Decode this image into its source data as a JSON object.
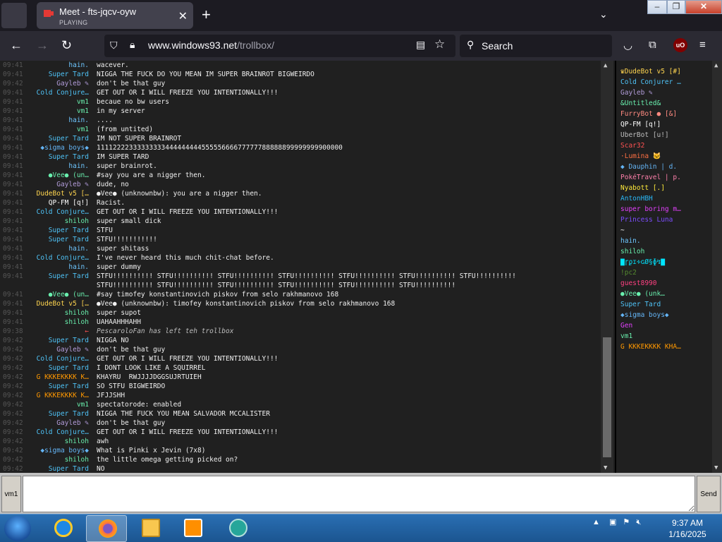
{
  "browser": {
    "tab_title": "Meet - fts-jqcv-oyw",
    "tab_status": "PLAYING",
    "url_host": "www.windows93.net",
    "url_path": "/trollbox/",
    "search_placeholder": "Search",
    "ublock_label": "uO"
  },
  "chat": {
    "messages": [
      {
        "time": "09:41",
        "nick": "hain.",
        "nick_color": "#6ec6ff",
        "text": "wacever."
      },
      {
        "time": "09:41",
        "nick": "Super Tard",
        "nick_color": "#4fc3f7",
        "text": "NIGGA THE FUCK DO YOU MEAN IM SUPER BRAINROT BIGWEIRDO"
      },
      {
        "time": "09:42",
        "nick": "Gayleb ✎",
        "nick_color": "#b39ddb",
        "text": "don't be that guy"
      },
      {
        "time": "09:41",
        "nick": "Cold Conjure…",
        "nick_color": "#4fc3f7",
        "text": "GET OUT OR I WILL FREEZE YOU INTENTIONALLY!!!"
      },
      {
        "time": "09:41",
        "nick": "vm1",
        "nick_color": "#69f0ae",
        "text": "becaue no bw users"
      },
      {
        "time": "09:41",
        "nick": "vm1",
        "nick_color": "#69f0ae",
        "text": "in my server"
      },
      {
        "time": "09:41",
        "nick": "hain.",
        "nick_color": "#6ec6ff",
        "text": "...."
      },
      {
        "time": "09:41",
        "nick": "vm1",
        "nick_color": "#69f0ae",
        "text": "(from untited)"
      },
      {
        "time": "09:41",
        "nick": "Super Tard",
        "nick_color": "#4fc3f7",
        "text": "IM NOT SUPER BRAINROT"
      },
      {
        "time": "09:41",
        "nick": "◆sigma boys◆",
        "nick_color": "#64b5f6",
        "text": "1111222233333333344444444455555666677777788888899999999900000"
      },
      {
        "time": "09:41",
        "nick": "Super Tard",
        "nick_color": "#4fc3f7",
        "text": "IM SUPER TARD"
      },
      {
        "time": "09:41",
        "nick": "hain.",
        "nick_color": "#6ec6ff",
        "text": "super brainrot."
      },
      {
        "time": "09:41",
        "nick": "●Vee● (un…",
        "nick_color": "#69f0ae",
        "text": "#say you are a nigger then."
      },
      {
        "time": "09:41",
        "nick": "Gayleb ✎",
        "nick_color": "#b39ddb",
        "text": "dude, no"
      },
      {
        "time": "09:41",
        "nick": "DudeBot v5 […",
        "nick_color": "#ffd54f",
        "text": "●Vee● (unknownbw): you are a nigger then."
      },
      {
        "time": "09:41",
        "nick": "QP-FM [q!]",
        "nick_color": "#ffffff",
        "text": "Racist."
      },
      {
        "time": "09:41",
        "nick": "Cold Conjure…",
        "nick_color": "#4fc3f7",
        "text": "GET OUT OR I WILL FREEZE YOU INTENTIONALLY!!!"
      },
      {
        "time": "09:41",
        "nick": "shiloh",
        "nick_color": "#69f0ae",
        "text": "super small dick"
      },
      {
        "time": "09:41",
        "nick": "Super Tard",
        "nick_color": "#4fc3f7",
        "text": "STFU"
      },
      {
        "time": "09:41",
        "nick": "Super Tard",
        "nick_color": "#4fc3f7",
        "text": "STFU!!!!!!!!!!!"
      },
      {
        "time": "09:41",
        "nick": "hain.",
        "nick_color": "#6ec6ff",
        "text": "super shitass"
      },
      {
        "time": "09:41",
        "nick": "Cold Conjure…",
        "nick_color": "#4fc3f7",
        "text": "I've never heard this much chit-chat before."
      },
      {
        "time": "09:41",
        "nick": "hain.",
        "nick_color": "#6ec6ff",
        "text": "super dummy"
      },
      {
        "time": "09:41",
        "nick": "Super Tard",
        "nick_color": "#4fc3f7",
        "text": "STFU!!!!!!!!!! STFU!!!!!!!!!! STFU!!!!!!!!!! STFU!!!!!!!!!! STFU!!!!!!!!!! STFU!!!!!!!!!! STFU!!!!!!!!!!"
      },
      {
        "time": "",
        "nick": "",
        "nick_color": "#4fc3f7",
        "text": "STFU!!!!!!!!!! STFU!!!!!!!!!! STFU!!!!!!!!!! STFU!!!!!!!!!! STFU!!!!!!!!!! STFU!!!!!!!!!!"
      },
      {
        "time": "09:41",
        "nick": "●Vee● (un…",
        "nick_color": "#69f0ae",
        "text": "#say timofey konstantinovich piskov from selo rakhmanovo 168"
      },
      {
        "time": "09:41",
        "nick": "DudeBot v5 […",
        "nick_color": "#ffd54f",
        "text": "●Vee● (unknownbw): timofey konstantinovich piskov from selo rakhmanovo 168"
      },
      {
        "time": "09:41",
        "nick": "shiloh",
        "nick_color": "#69f0ae",
        "text": "super supot"
      },
      {
        "time": "09:41",
        "nick": "shiloh",
        "nick_color": "#69f0ae",
        "text": "UAHAAHHHAHH"
      },
      {
        "time": "09:38",
        "nick": "←",
        "nick_color": "#ff5252",
        "text": "PescaroloFan has left teh trollbox",
        "event": true
      },
      {
        "time": "09:42",
        "nick": "Super Tard",
        "nick_color": "#4fc3f7",
        "text": "NIGGA NO"
      },
      {
        "time": "09:42",
        "nick": "Gayleb ✎",
        "nick_color": "#b39ddb",
        "text": "don't be that guy"
      },
      {
        "time": "09:42",
        "nick": "Cold Conjure…",
        "nick_color": "#4fc3f7",
        "text": "GET OUT OR I WILL FREEZE YOU INTENTIONALLY!!!"
      },
      {
        "time": "09:42",
        "nick": "Super Tard",
        "nick_color": "#4fc3f7",
        "text": "I DONT LOOK LIKE A SQUIRREL"
      },
      {
        "time": "09:42",
        "nick": "G KKKEKKKK K…",
        "nick_color": "#ff9800",
        "text": "KHAYRU  RWJJJJDGGSUJRTUIEH"
      },
      {
        "time": "09:42",
        "nick": "Super Tard",
        "nick_color": "#4fc3f7",
        "text": "SO STFU BIGWEIRDO"
      },
      {
        "time": "09:42",
        "nick": "G KKKEKKKK K…",
        "nick_color": "#ff9800",
        "text": "JFJJSHH"
      },
      {
        "time": "09:42",
        "nick": "vm1",
        "nick_color": "#69f0ae",
        "text": "spectatorode: enabled"
      },
      {
        "time": "09:42",
        "nick": "Super Tard",
        "nick_color": "#4fc3f7",
        "text": "NIGGA THE FUCK YOU MEAN SALVADOR MCCALISTER"
      },
      {
        "time": "09:42",
        "nick": "Gayleb ✎",
        "nick_color": "#b39ddb",
        "text": "don't be that guy"
      },
      {
        "time": "09:42",
        "nick": "Cold Conjure…",
        "nick_color": "#4fc3f7",
        "text": "GET OUT OR I WILL FREEZE YOU INTENTIONALLY!!!"
      },
      {
        "time": "09:42",
        "nick": "shiloh",
        "nick_color": "#69f0ae",
        "text": "awh"
      },
      {
        "time": "09:42",
        "nick": "◆sigma boys◆",
        "nick_color": "#64b5f6",
        "text": "What is Pinki x Jevin (7x8)"
      },
      {
        "time": "09:42",
        "nick": "shiloh",
        "nick_color": "#69f0ae",
        "text": "the little omega getting picked on?"
      },
      {
        "time": "09:42",
        "nick": "Super Tard",
        "nick_color": "#4fc3f7",
        "text": "NO"
      }
    ]
  },
  "users": [
    {
      "name": "♛DudeBot v5 [#]",
      "color": "#ffd54f"
    },
    {
      "name": "Cold Conjurer …",
      "color": "#4fc3f7"
    },
    {
      "name": "Gayleb ✎",
      "color": "#b39ddb"
    },
    {
      "name": "&Untitled&",
      "color": "#69f0ae"
    },
    {
      "name": "FurryBot ● [&]",
      "color": "#ff8a80"
    },
    {
      "name": "QP-FM [q!]",
      "color": "#ffffff"
    },
    {
      "name": "UberBot [u!]",
      "color": "#bdbdbd"
    },
    {
      "name": "Scar32",
      "color": "#ff5252"
    },
    {
      "name": "·Lumina 🐱",
      "color": "#ff7043"
    },
    {
      "name": "◆ Dauphin | d.",
      "color": "#64b5f6"
    },
    {
      "name": "PokéTravel | p.",
      "color": "#ff80ab"
    },
    {
      "name": "Nyabott [.]",
      "color": "#ffeb3b"
    },
    {
      "name": "AntonHBH",
      "color": "#29b6f6"
    },
    {
      "name": "super boring m…",
      "color": "#e040fb"
    },
    {
      "name": "Princess Luna",
      "color": "#7c4dff"
    },
    {
      "name": "~",
      "color": "#ffffff"
    },
    {
      "name": "hain.",
      "color": "#6ec6ff"
    },
    {
      "name": "shiloh",
      "color": "#69f0ae"
    },
    {
      "name": "▇ɼϼɪ∻ɢØ§ɸ↯▇",
      "color": "#00e5ff"
    },
    {
      "name": "!pc2",
      "color": "#558b2f"
    },
    {
      "name": "guest8990",
      "color": "#ff4081"
    },
    {
      "name": "●Vee● (unk…",
      "color": "#69f0ae"
    },
    {
      "name": "Super Tard",
      "color": "#4fc3f7"
    },
    {
      "name": "◆sigma boys◆",
      "color": "#64b5f6"
    },
    {
      "name": "Gen",
      "color": "#e040fb"
    },
    {
      "name": "vm1",
      "color": "#69f0ae"
    },
    {
      "name": "G KKKEKKKK KHA…",
      "color": "#ff9800"
    }
  ],
  "input": {
    "nick_label": "vm1",
    "send_label": "Send",
    "value": ""
  },
  "taskbar": {
    "time": "9:37 AM",
    "date": "1/16/2025"
  }
}
